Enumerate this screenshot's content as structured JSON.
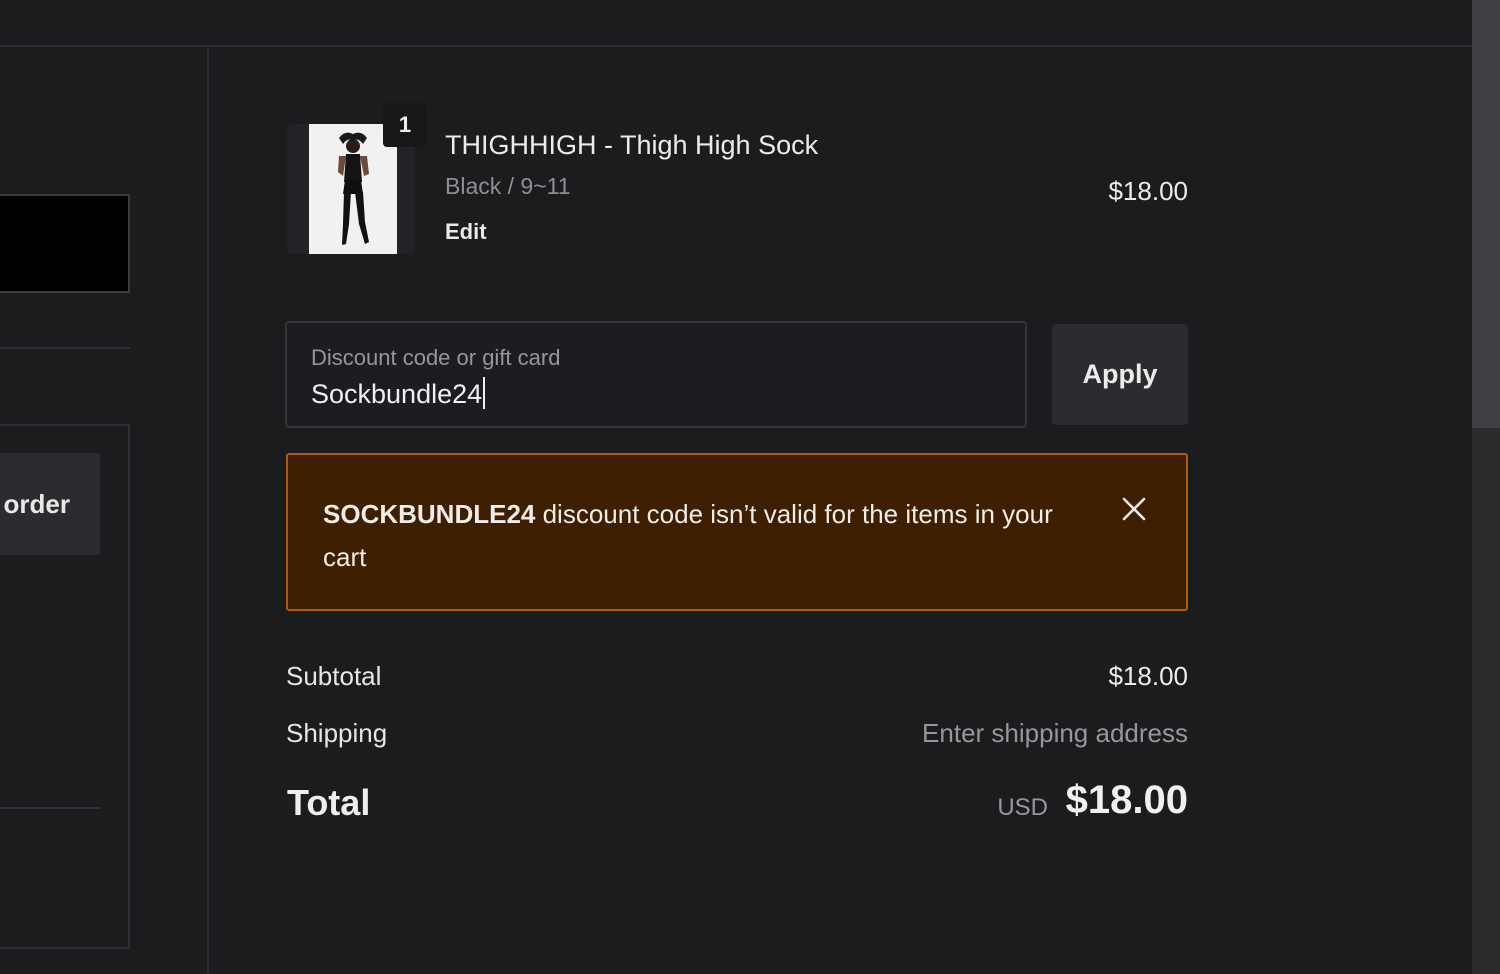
{
  "left": {
    "order_label": "order"
  },
  "product": {
    "quantity": "1",
    "title": "THIGHHIGH - Thigh High Sock",
    "variant": "Black / 9~11",
    "edit_label": "Edit",
    "price": "$18.00"
  },
  "discount": {
    "label": "Discount code or gift card",
    "value": "Sockbundle24",
    "apply_label": "Apply"
  },
  "alert": {
    "code": "SOCKBUNDLE24",
    "message": " discount code isn’t valid for the items in your cart"
  },
  "summary": {
    "subtotal_label": "Subtotal",
    "subtotal_value": "$18.00",
    "shipping_label": "Shipping",
    "shipping_value": "Enter shipping address",
    "total_label": "Total",
    "currency": "USD",
    "total_value": "$18.00"
  },
  "colors": {
    "background": "#1b1c1e",
    "alert_bg": "#3e1f02",
    "alert_border": "#b05a0c"
  }
}
